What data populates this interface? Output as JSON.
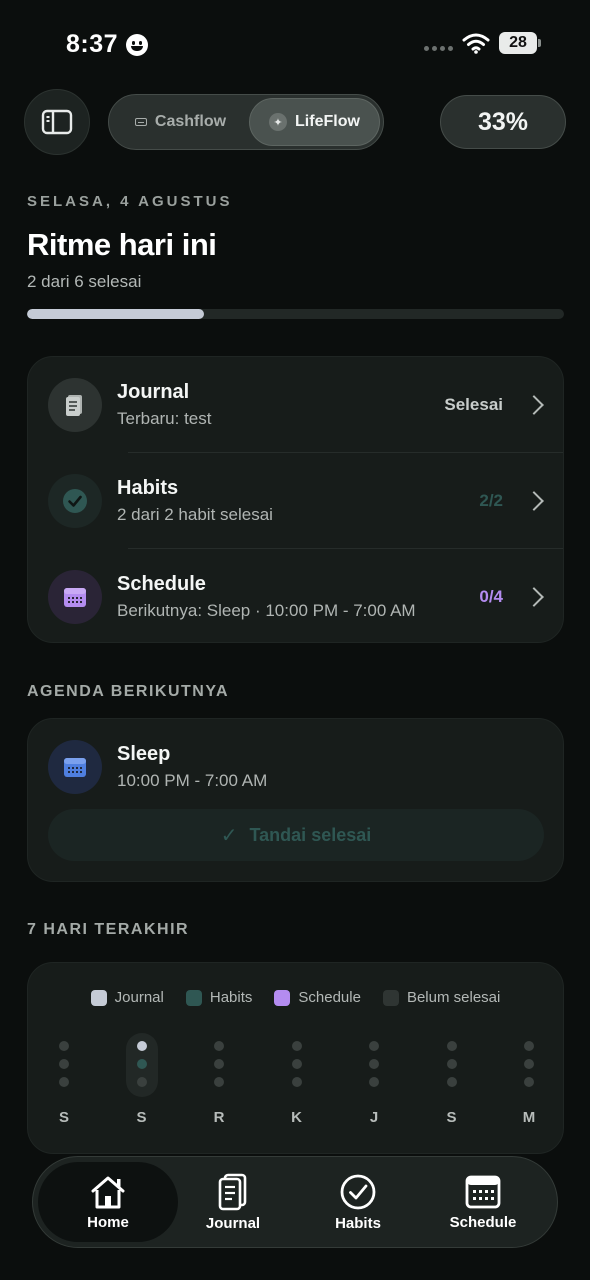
{
  "status_bar": {
    "time": "8:37",
    "battery": "28"
  },
  "topbar": {
    "seg_cashflow": "Cashflow",
    "seg_lifeflow": "LifeFlow",
    "percent": "33%"
  },
  "header": {
    "date": "SELASA, 4 AGUSTUS",
    "title": "Ritme hari ini",
    "progress_text": "2 dari 6 selesai",
    "progress_fraction": 0.33
  },
  "summary": {
    "journal": {
      "title": "Journal",
      "subtitle": "Terbaru: test",
      "status": "Selesai"
    },
    "habits": {
      "title": "Habits",
      "subtitle": "2 dari 2 habit selesai",
      "status": "2/2"
    },
    "schedule": {
      "title": "Schedule",
      "subtitle": "Berikutnya: Sleep · 10:00 PM - 7:00 AM",
      "status": "0/4"
    }
  },
  "agenda": {
    "section_label": "AGENDA BERIKUTNYA",
    "title": "Sleep",
    "time": "10:00 PM - 7:00 AM",
    "mark_done": "Tandai selesai"
  },
  "week": {
    "section_label": "7 HARI TERAKHIR",
    "legend": {
      "journal": "Journal",
      "habits": "Habits",
      "schedule": "Schedule",
      "pending": "Belum selesai"
    },
    "days": [
      {
        "label": "S",
        "journal": false,
        "habits": false,
        "schedule": false,
        "today": false
      },
      {
        "label": "S",
        "journal": true,
        "habits": true,
        "schedule": false,
        "today": true
      },
      {
        "label": "R",
        "journal": false,
        "habits": false,
        "schedule": false,
        "today": false
      },
      {
        "label": "K",
        "journal": false,
        "habits": false,
        "schedule": false,
        "today": false
      },
      {
        "label": "J",
        "journal": false,
        "habits": false,
        "schedule": false,
        "today": false
      },
      {
        "label": "S",
        "journal": false,
        "habits": false,
        "schedule": false,
        "today": false
      },
      {
        "label": "M",
        "journal": false,
        "habits": false,
        "schedule": false,
        "today": false
      }
    ]
  },
  "tabs": {
    "home": "Home",
    "journal": "Journal",
    "habits": "Habits",
    "schedule": "Schedule"
  },
  "colors": {
    "journal": "#c5cbd6",
    "habits": "#2f5753",
    "schedule": "#b48cf0",
    "pending": "#2f3533"
  }
}
